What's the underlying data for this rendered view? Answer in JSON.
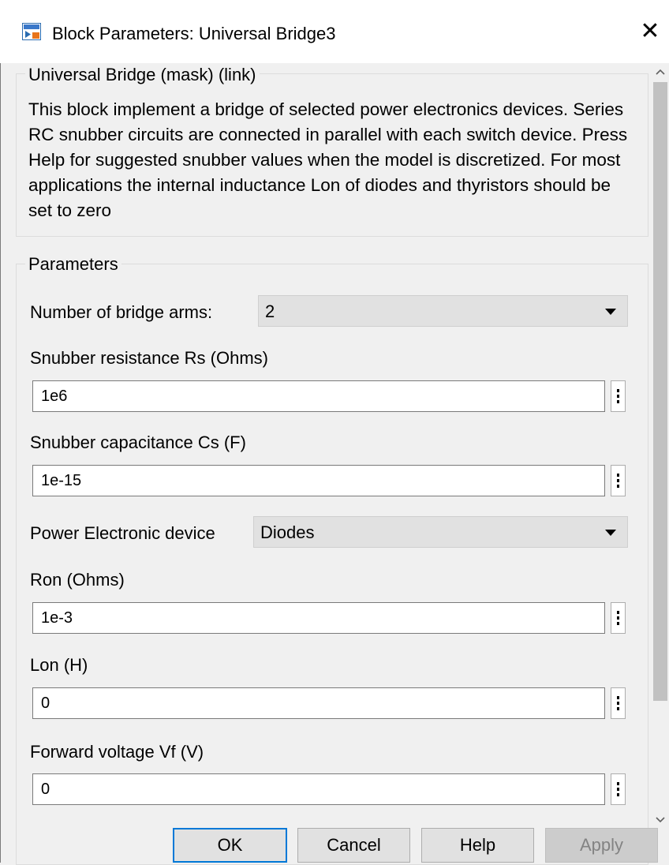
{
  "window": {
    "title": "Block Parameters: Universal Bridge3",
    "close_glyph": "✕",
    "icon": "simulink-block-icon"
  },
  "mask_group": {
    "legend": "Universal Bridge (mask) (link)",
    "description": "This block implement a bridge of selected power electronics devices.  Series RC snubber circuits are connected in parallel with each switch device.  Press Help for suggested snubber values when the model is discretized. For most applications the internal inductance Lon of diodes and thyristors should be set to zero"
  },
  "parameters": {
    "legend": "Parameters",
    "bridge_arms": {
      "label": "Number of bridge arms:",
      "value": "2"
    },
    "snubber_resistance": {
      "label": "Snubber resistance Rs (Ohms)",
      "value": "1e6"
    },
    "snubber_capacitance": {
      "label": "Snubber capacitance Cs (F)",
      "value": "1e-15"
    },
    "device": {
      "label": "Power Electronic device",
      "value": "Diodes"
    },
    "ron": {
      "label": "Ron (Ohms)",
      "value": "1e-3"
    },
    "lon": {
      "label": "Lon (H)",
      "value": "0"
    },
    "vf": {
      "label": "Forward voltage Vf (V)",
      "value": "0"
    }
  },
  "buttons": {
    "ok": "OK",
    "cancel": "Cancel",
    "help": "Help",
    "apply": "Apply"
  },
  "colors": {
    "accent": "#0078d7",
    "dialog_bg": "#f0f0f0",
    "field_border": "#7a7a7a"
  }
}
